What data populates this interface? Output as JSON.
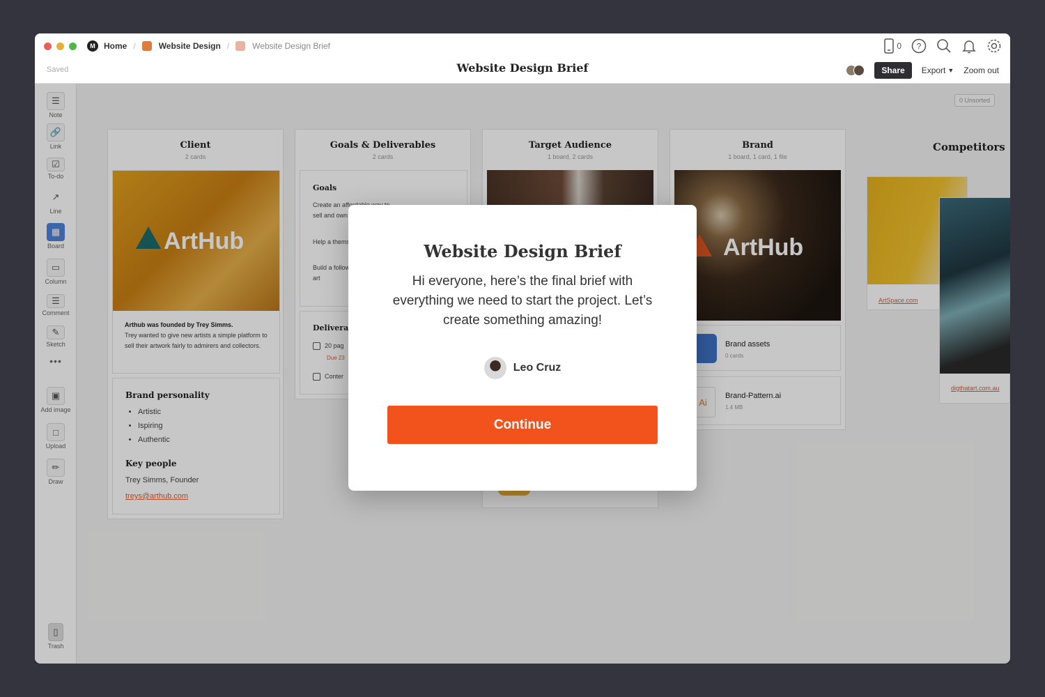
{
  "topbar": {
    "crumbs": [
      {
        "label": "Home"
      },
      {
        "label": "Website Design"
      },
      {
        "label": "Website Design Brief"
      }
    ],
    "colors": {
      "website_design": "#e07a3c",
      "brief": "#e8b3a0"
    },
    "saved": "Saved",
    "title": "Website Design Brief",
    "device_count": "0",
    "share": "Share",
    "export": "Export",
    "zoom": "Zoom out"
  },
  "sidebar": {
    "tools": [
      {
        "label": "Note",
        "icon": "note-icon"
      },
      {
        "label": "Link",
        "icon": "link-icon"
      },
      {
        "label": "To-do",
        "icon": "todo-icon"
      },
      {
        "label": "Line",
        "icon": "line-icon"
      },
      {
        "label": "Board",
        "icon": "board-icon"
      },
      {
        "label": "Column",
        "icon": "column-icon"
      },
      {
        "label": "Comment",
        "icon": "comment-icon"
      },
      {
        "label": "Sketch",
        "icon": "sketch-icon"
      },
      {
        "label": "Add image",
        "icon": "add-image-icon"
      },
      {
        "label": "Upload",
        "icon": "upload-icon"
      },
      {
        "label": "Draw",
        "icon": "draw-icon"
      }
    ],
    "trash": "Trash"
  },
  "canvas": {
    "unsorted": "0 Unsorted",
    "client": {
      "title": "Client",
      "count": "2 cards",
      "logo": "ArtHub",
      "founded": "Arthub was founded by Trey Simms.",
      "desc": "Trey wanted to give new artists a simple platform to sell their artwork fairly to admirers and collectors.",
      "personality_title": "Brand personality",
      "personality": [
        "Artistic",
        "Ispiring",
        "Authentic"
      ],
      "people_title": "Key people",
      "person": "Trey Simms, Founder",
      "email": "treys@arthub.com"
    },
    "goals": {
      "title": "Goals & Deliverables",
      "count": "2 cards",
      "goals_title": "Goals",
      "items": [
        "Create an affordable way to sell and own ar increas",
        "Help a thems",
        "Build a follow art"
      ],
      "deliverables_title": "Deliverab",
      "todo1": "20 pag",
      "due": "Due 23",
      "todo2": "Conter"
    },
    "audience": {
      "title": "Target Audience",
      "count": "1 board, 2 cards"
    },
    "brand": {
      "title": "Brand",
      "count": "1 board, 1 card, 1 file",
      "logo": "ArtHub",
      "assets": "Brand assets",
      "assets_count": "0 cards",
      "file": "Brand-Pattern.ai",
      "file_size": "1.4 MB",
      "file_tag": "Ai"
    },
    "competitors": {
      "title": "Competitors",
      "link1": "ArtSpace.com",
      "link2": "digthatart.com.au"
    }
  },
  "modal": {
    "title": "Website Design Brief",
    "body": "Hi everyone, here’s the final brief with everything we need to start the project. Let’s create something amazing!",
    "author": "Leo Cruz",
    "button": "Continue"
  }
}
